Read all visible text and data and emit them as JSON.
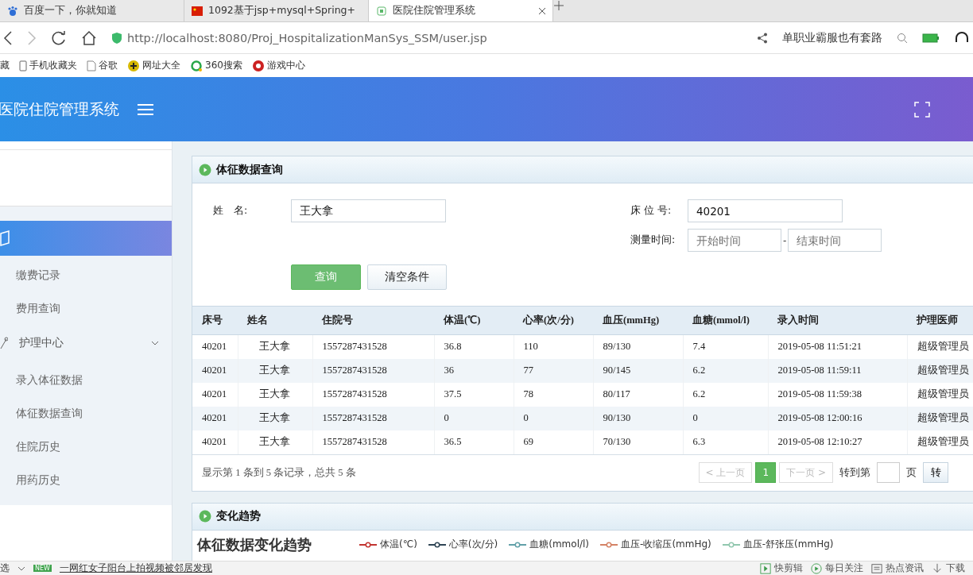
{
  "browser": {
    "tabs": [
      {
        "title": "百度一下，你就知道",
        "selected": false,
        "kind": "paw"
      },
      {
        "title": "1092基于jsp+mysql+Spring+",
        "selected": false,
        "kind": "flag"
      },
      {
        "title": "医院住院管理系统",
        "selected": true,
        "kind": "site"
      }
    ],
    "url": "http://localhost:8080/Proj_HospitalizationManSys_SSM/user.jsp",
    "search_text": "单职业霸服也有套路",
    "bookmarks": [
      {
        "label": "藏",
        "kind": "caret"
      },
      {
        "label": "手机收藏夹",
        "kind": "phone"
      },
      {
        "label": "谷歌",
        "kind": "page"
      },
      {
        "label": "网址大全",
        "kind": "plus"
      },
      {
        "label": "360搜索",
        "kind": "ring"
      },
      {
        "label": "游戏中心",
        "kind": "game"
      }
    ]
  },
  "header": {
    "title": "医院住院管理系统"
  },
  "sidebar": {
    "groups": [
      {
        "selected": true,
        "expanded": true,
        "kind": "book",
        "children": [
          {
            "label": "缴费记录",
            "selected": false
          },
          {
            "label": "费用查询",
            "selected": false
          }
        ]
      },
      {
        "label": "护理中心",
        "selected": false,
        "expanded": true,
        "kind": "pin",
        "children": [
          {
            "label": "录入体征数据",
            "selected": false
          },
          {
            "label": "体征数据查询",
            "selected": false
          },
          {
            "label": "住院历史",
            "selected": false
          },
          {
            "label": "用药历史",
            "selected": false
          }
        ]
      }
    ]
  },
  "query_panel": {
    "title": "体征数据查询",
    "name_field": {
      "label": "姓　名:",
      "value": "王大拿"
    },
    "bed_field": {
      "label": "床 位 号:",
      "value": "40201"
    },
    "time_field": {
      "label": "测量时间:",
      "start_placeholder": "开始时间",
      "separator": "-",
      "end_placeholder": "结束时间"
    },
    "buttons": [
      {
        "label": "查询",
        "kind": "primary"
      },
      {
        "label": "清空条件",
        "kind": "plain"
      }
    ]
  },
  "table": {
    "columns": [
      "床号",
      "姓名",
      "住院号",
      "体温(℃)",
      "心率(次/分)",
      "血压(mmHg)",
      "血糖(mmol/l)",
      "录入时间",
      "护理医师"
    ],
    "rows": [
      [
        "40201",
        "王大拿",
        "1557287431528",
        "36.8",
        "110",
        "89/130",
        "7.4",
        "2019-05-08 11:51:21",
        "超级管理员"
      ],
      [
        "40201",
        "王大拿",
        "1557287431528",
        "36",
        "77",
        "90/145",
        "6.2",
        "2019-05-08 11:59:11",
        "超级管理员"
      ],
      [
        "40201",
        "王大拿",
        "1557287431528",
        "37.5",
        "78",
        "80/117",
        "6.2",
        "2019-05-08 11:59:38",
        "超级管理员"
      ],
      [
        "40201",
        "王大拿",
        "1557287431528",
        "0",
        "0",
        "90/130",
        "0",
        "2019-05-08 12:00:16",
        "超级管理员"
      ],
      [
        "40201",
        "王大拿",
        "1557287431528",
        "36.5",
        "69",
        "70/130",
        "6.3",
        "2019-05-08 12:10:27",
        "超级管理员"
      ]
    ]
  },
  "pagination": {
    "summary": "显示第 1 条到 5 条记录，总共 5 条",
    "prev": "< 上一页",
    "pages": [
      {
        "label": "1",
        "selected": true
      }
    ],
    "next": "下一页 >",
    "goto_label": "转到第",
    "page_unit": "页",
    "go": "转"
  },
  "trend_panel": {
    "title": "变化趋势",
    "chart_title": "体征数据变化趋势",
    "legend": [
      {
        "label": "体温(℃)",
        "color": "#c23531"
      },
      {
        "label": "心率(次/分)",
        "color": "#2f4554"
      },
      {
        "label": "血糖(mmol/l)",
        "color": "#61a0a8"
      },
      {
        "label": "血压-收缩压(mmHg)",
        "color": "#d48265"
      },
      {
        "label": "血压-舒张压(mmHg)",
        "color": "#91c7ae"
      }
    ]
  },
  "status_bar": {
    "left": "选",
    "badge": "NEW",
    "news": "一网红女子阳台上拍视频被邻居发现",
    "tools": [
      {
        "label": "快剪辑",
        "kind": "clip"
      },
      {
        "label": "每日关注",
        "kind": "play"
      },
      {
        "label": "热点资讯",
        "kind": "news"
      },
      {
        "label": "下载",
        "kind": "download"
      }
    ]
  }
}
